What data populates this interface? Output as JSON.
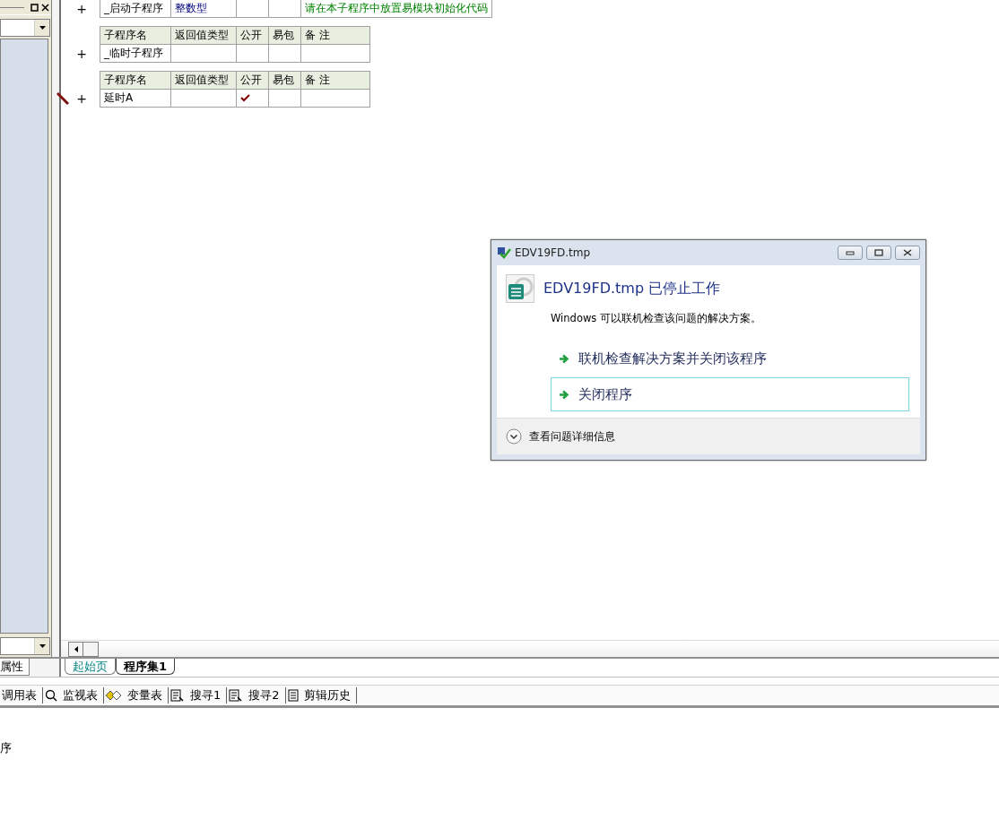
{
  "left_panel": {
    "tabs": [
      {
        "label": "属性",
        "selected": true
      }
    ]
  },
  "program_tables": [
    {
      "rows": [
        {
          "name": "_启动子程序",
          "return_type": "整数型",
          "public": false,
          "easy_package": false,
          "remark": "请在本子程序中放置易模块初始化代码",
          "editing": false
        }
      ]
    },
    {
      "columns": [
        "子程序名",
        "返回值类型",
        "公开",
        "易包",
        "备 注"
      ],
      "rows": [
        {
          "name": "_临时子程序",
          "public": false,
          "easy_package": false,
          "editing": false
        }
      ]
    },
    {
      "columns": [
        "子程序名",
        "返回值类型",
        "公开",
        "易包",
        "备 注"
      ],
      "rows": [
        {
          "name": "延时A",
          "public": true,
          "easy_package": false,
          "editing": true
        }
      ]
    }
  ],
  "row_expander": "+",
  "editor_tabs": [
    {
      "label": "起始页",
      "selected": false
    },
    {
      "label": "程序集1",
      "selected": true
    }
  ],
  "toolbar": [
    {
      "label": "调用表",
      "kind": "none"
    },
    {
      "label": "监视表",
      "kind": "magnifier"
    },
    {
      "label": "变量表",
      "kind": "diamonds"
    },
    {
      "label": "搜寻1",
      "kind": "find"
    },
    {
      "label": "搜寻2",
      "kind": "find"
    },
    {
      "label": "剪辑历史",
      "kind": "document"
    }
  ],
  "output": {
    "text": "序"
  },
  "dialog": {
    "title": "EDV19FD.tmp",
    "heading": "EDV19FD.tmp 已停止工作",
    "message": "Windows 可以联机检查该问题的解决方案。",
    "options": [
      {
        "label": "联机检查解决方案并关闭该程序",
        "selected": false
      },
      {
        "label": "关闭程序",
        "selected": true
      }
    ],
    "details": "查看问题详细信息"
  }
}
